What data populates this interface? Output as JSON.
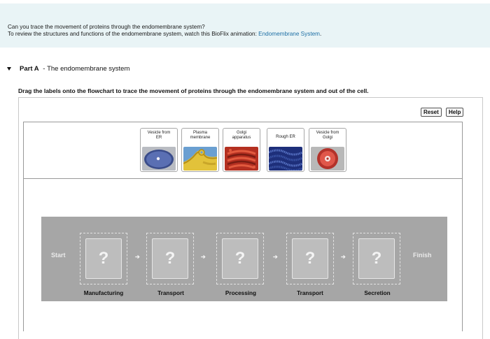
{
  "top_icon": "▮▮",
  "intro": {
    "question": "Can you trace the movement of proteins through the endomembrane system?",
    "review_prefix": "To review the structures and functions of the endomembrane system, watch this BioFlix animation: ",
    "link_text": "Endomembrane System",
    "link_suffix": "."
  },
  "part": {
    "label": "Part A",
    "separator": " - ",
    "title": "The endomembrane system"
  },
  "instruction": "Drag the labels onto the flowchart to trace the movement of proteins through the endomembrane system and out of the cell.",
  "toolbar": {
    "reset_label": "Reset",
    "help_label": "Help"
  },
  "labels": [
    {
      "text_line1": "Vesicle from",
      "text_line2": "ER",
      "icon": "vesicle-er-image"
    },
    {
      "text_line1": "Plasma",
      "text_line2": "membrane",
      "icon": "plasma-membrane-image"
    },
    {
      "text_line1": "Golgi",
      "text_line2": "apparatus",
      "icon": "golgi-apparatus-image"
    },
    {
      "text_line1": "Rough ER",
      "text_line2": "",
      "icon": "rough-er-image"
    },
    {
      "text_line1": "Vesicle from",
      "text_line2": "Golgi",
      "icon": "vesicle-golgi-image"
    }
  ],
  "flowchart": {
    "start_label": "Start",
    "finish_label": "Finish",
    "placeholder": "?",
    "arrow": "➔",
    "stages": [
      "Manufacturing",
      "Transport",
      "Processing",
      "Transport",
      "Secretion"
    ]
  },
  "colors": {
    "intro_bg": "#e9f4f6",
    "link": "#1d6fa5",
    "flow_bg": "#a6a6a6"
  }
}
